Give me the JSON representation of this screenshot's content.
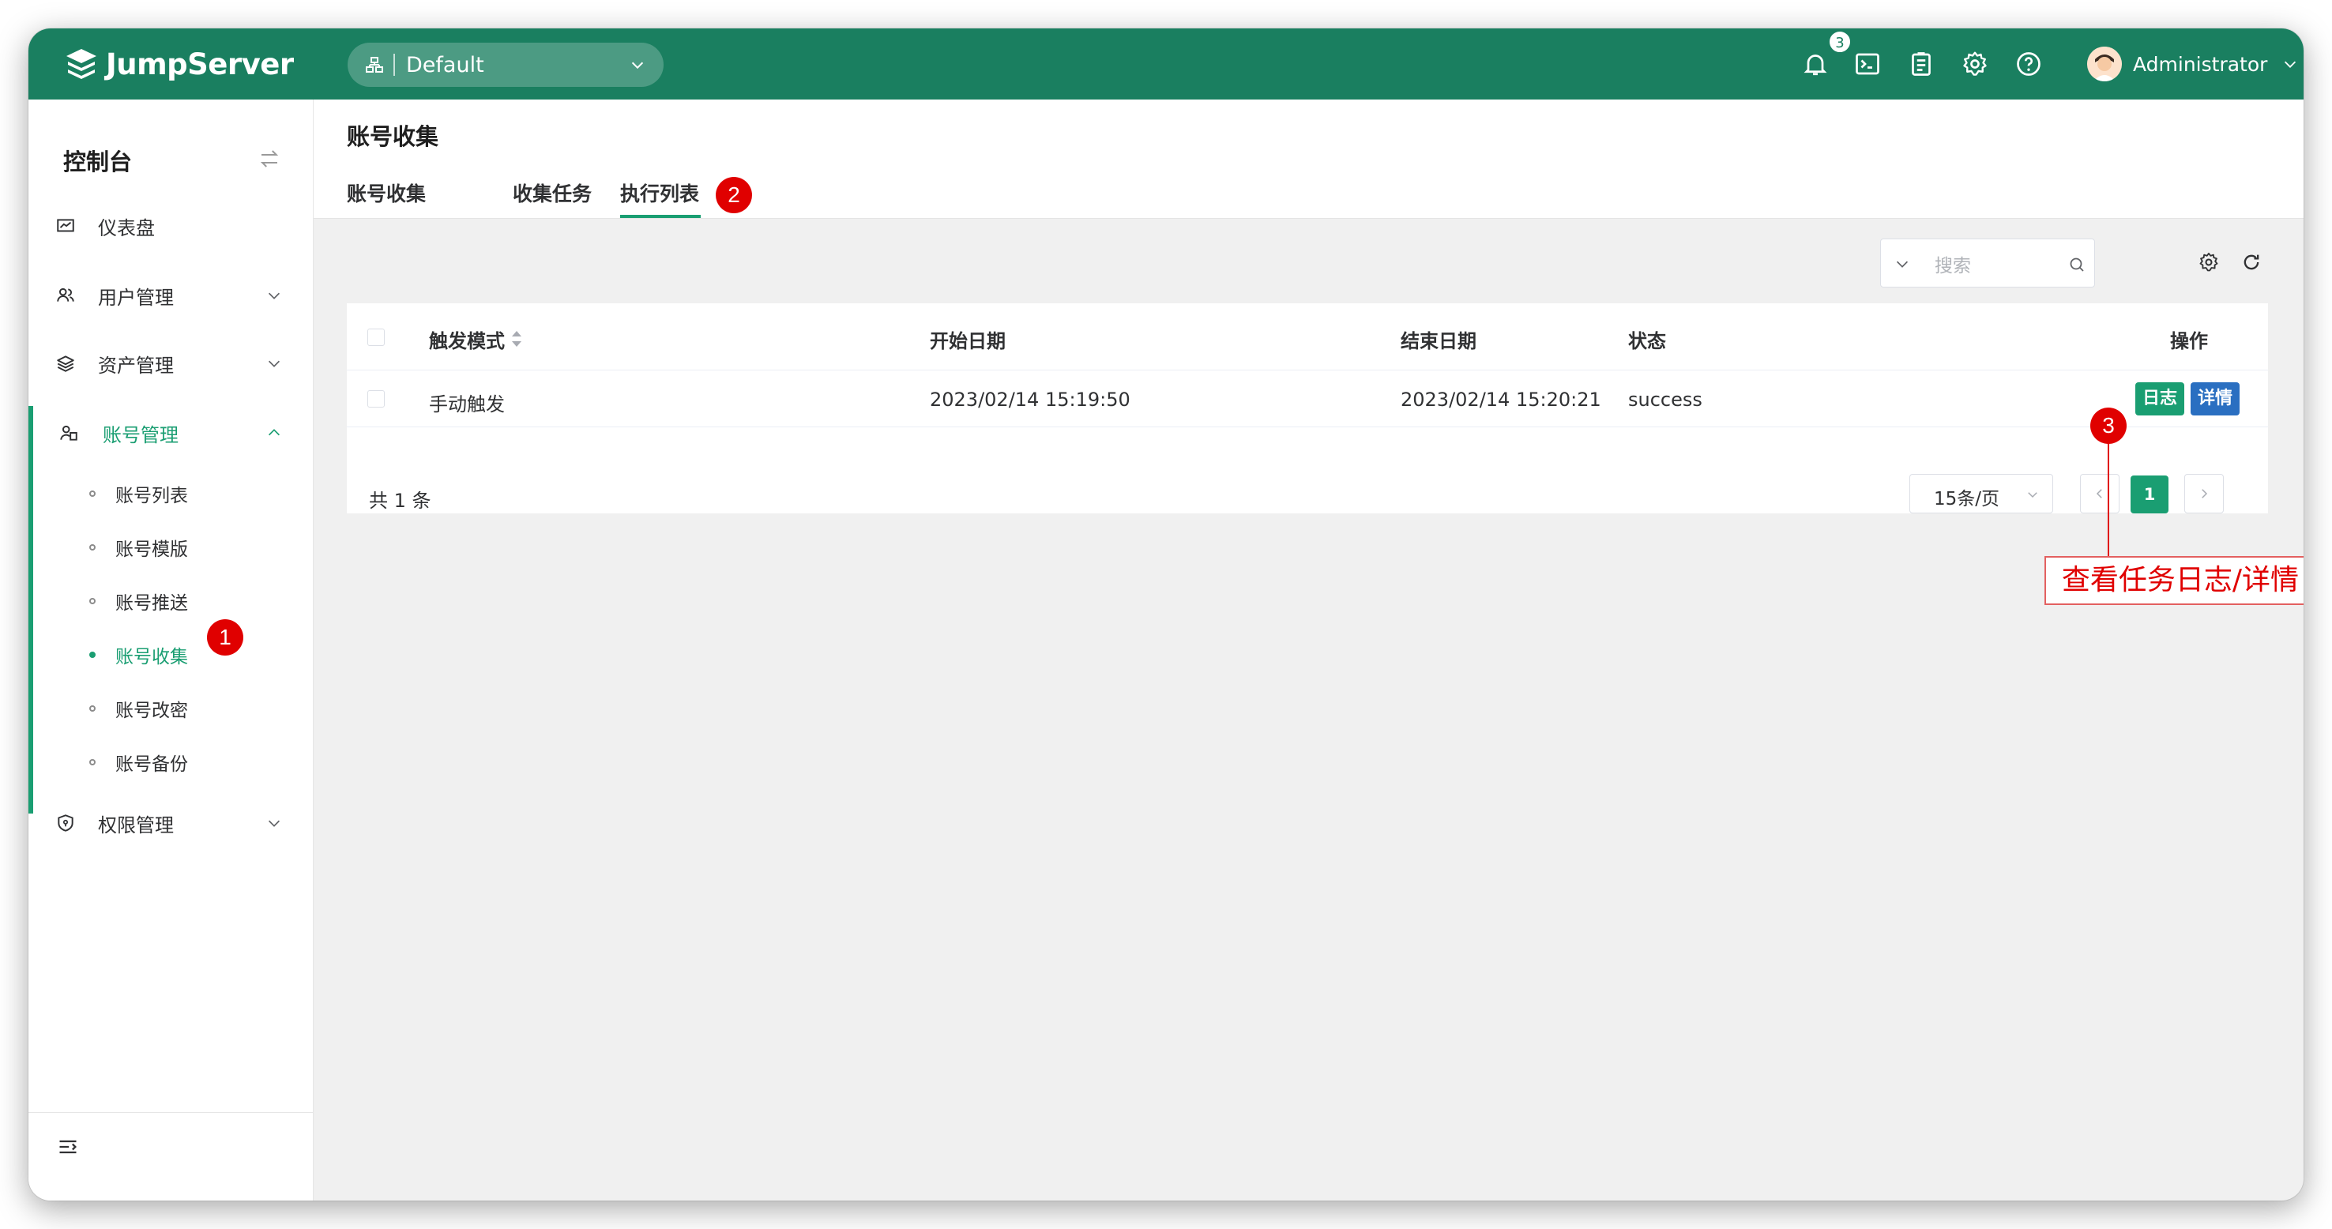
{
  "app": {
    "name": "JumpServer"
  },
  "topbar": {
    "org_label": "Default",
    "notification_count": "3",
    "user_name": "Administrator",
    "icons": [
      "bell-icon",
      "terminal-icon",
      "clipboard-icon",
      "gear-icon",
      "help-icon"
    ],
    "brand_color": "#1a7f60"
  },
  "sidebar": {
    "title": "控制台",
    "items": [
      {
        "label": "仪表盘",
        "icon": "dashboard-icon"
      },
      {
        "label": "用户管理",
        "icon": "users-icon"
      },
      {
        "label": "资产管理",
        "icon": "layers-icon"
      },
      {
        "label": "账号管理",
        "icon": "account-icon"
      },
      {
        "label": "权限管理",
        "icon": "shield-icon"
      }
    ],
    "sub_items": [
      "账号列表",
      "账号模版",
      "账号推送",
      "账号收集",
      "账号改密",
      "账号备份"
    ],
    "active_sub": "账号收集",
    "accent_color": "#1a9e72"
  },
  "header": {
    "title": "账号收集",
    "tabs": [
      "账号收集",
      "收集任务",
      "执行列表"
    ],
    "active_tab": "执行列表"
  },
  "toolbar": {
    "search_placeholder": "搜索"
  },
  "table": {
    "columns": [
      "触发模式",
      "开始日期",
      "结束日期",
      "状态",
      "操作"
    ],
    "rows": [
      {
        "trigger": "手动触发",
        "start": "2023/02/14 15:19:50",
        "end": "2023/02/14 15:20:21",
        "status": "success"
      }
    ],
    "actions": {
      "log": "日志",
      "detail": "详情"
    }
  },
  "pagination": {
    "total_text": "共 1 条",
    "page_size": "15条/页",
    "current_page": "1"
  },
  "annotations": {
    "step1": "1",
    "step2": "2",
    "step3": "3",
    "callout": "查看任务日志/详情"
  }
}
